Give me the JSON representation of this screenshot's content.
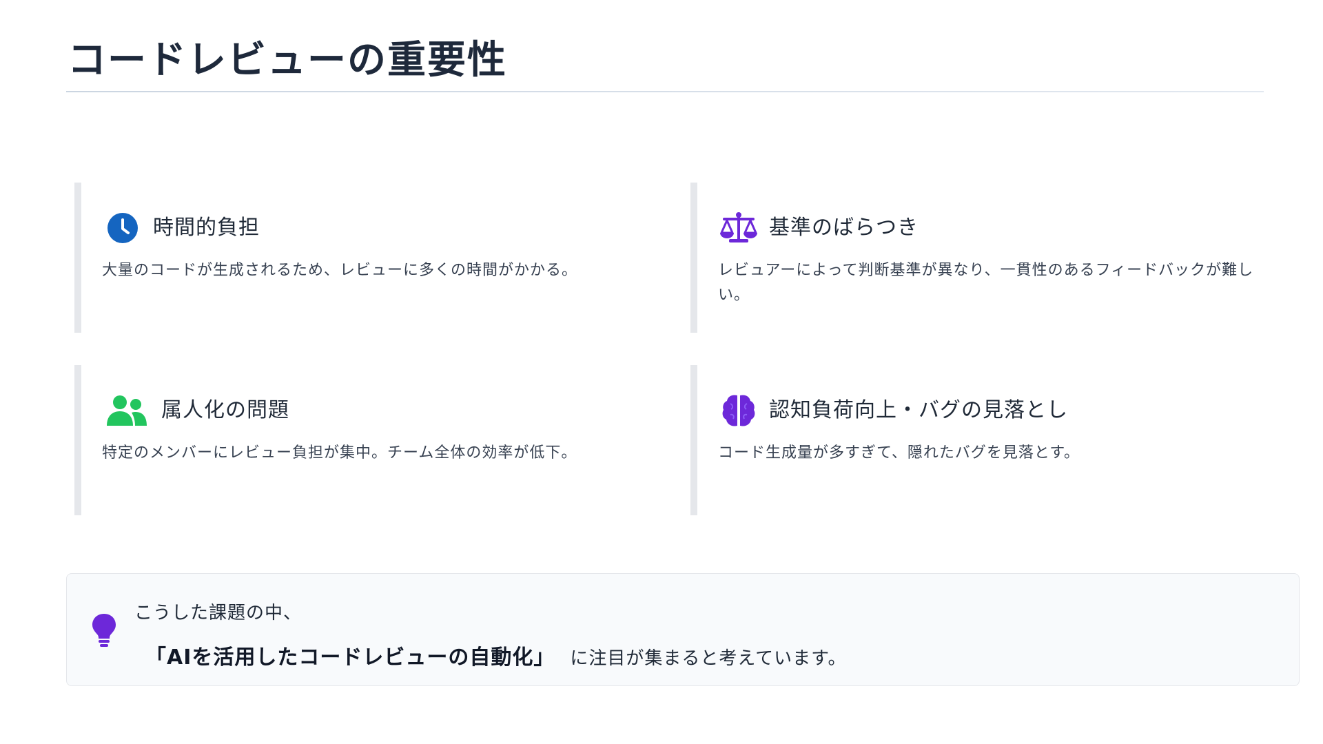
{
  "slide": {
    "title": "コードレビューの重要性"
  },
  "cards": [
    {
      "title": "時間的負担",
      "description": "大量のコードが生成されるため、レビューに多くの時間がかかる。",
      "icon": "clock-icon",
      "icon_color": "#1565c0"
    },
    {
      "title": "基準のばらつき",
      "description": "レビュアーによって判断基準が異なり、一貫性のあるフィードバックが難しい。",
      "icon": "scale-icon",
      "icon_color": "#6d28d9"
    },
    {
      "title": "属人化の問題",
      "description": "特定のメンバーにレビュー負担が集中。チーム全体の効率が低下。",
      "icon": "users-icon",
      "icon_color": "#22c55e"
    },
    {
      "title": "認知負荷向上・バグの見落とし",
      "description": "コード生成量が多すぎて、隠れたバグを見落とす。",
      "icon": "brain-icon",
      "icon_color": "#6d28d9"
    }
  ],
  "callout": {
    "icon": "lightbulb-icon",
    "icon_color": "#6d28d9",
    "line1": "こうした課題の中、",
    "emphasis": "「AIを活用したコードレビューの自動化」",
    "rest": "に注目が集まると考えています。"
  }
}
